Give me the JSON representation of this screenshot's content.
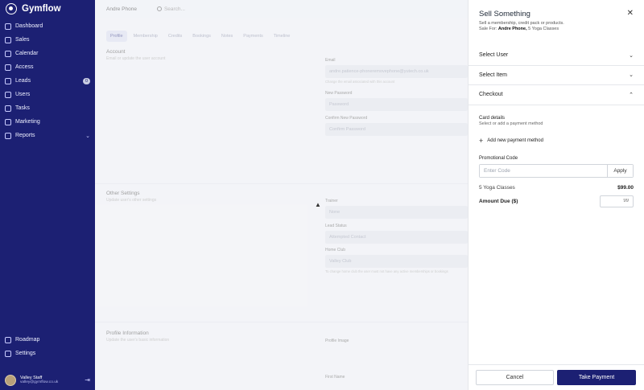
{
  "brand": {
    "name": "Gymflow"
  },
  "sidebar": {
    "items": [
      {
        "label": "Dashboard",
        "icon": "dashboard-icon"
      },
      {
        "label": "Sales",
        "icon": "sales-icon"
      },
      {
        "label": "Calendar",
        "icon": "calendar-icon"
      },
      {
        "label": "Access",
        "icon": "access-icon"
      },
      {
        "label": "Leads",
        "icon": "leads-icon",
        "badge": "0"
      },
      {
        "label": "Users",
        "icon": "users-icon"
      },
      {
        "label": "Tasks",
        "icon": "tasks-icon"
      },
      {
        "label": "Marketing",
        "icon": "marketing-icon"
      },
      {
        "label": "Reports",
        "icon": "reports-icon"
      }
    ],
    "bottom_items": [
      {
        "label": "Roadmap",
        "icon": "roadmap-icon"
      },
      {
        "label": "Settings",
        "icon": "settings-icon"
      }
    ],
    "user": {
      "name": "Valley Staff",
      "email": "valley@gymflow.co.uk"
    }
  },
  "topbar": {
    "member_name": "Andre Phone",
    "search_placeholder": "Search..."
  },
  "tabs": [
    "Profile",
    "Membership",
    "Credits",
    "Bookings",
    "Notes",
    "Payments",
    "Timeline"
  ],
  "main": {
    "account": {
      "title": "Account",
      "subtitle": "Email or update the user account",
      "email_label": "Email",
      "email_value": "andre.patience-phoneremovephone@yutech.co.uk",
      "email_help": "Change the email associated with this account",
      "new_password_label": "New Password",
      "new_password_placeholder": "Password",
      "confirm_password_label": "Confirm New Password",
      "confirm_password_placeholder": "Confirm Password"
    },
    "other": {
      "title": "Other Settings",
      "subtitle": "Update user's other settings",
      "trainer_label": "Trainer",
      "trainer_value": "None",
      "lead_status_label": "Lead Status",
      "lead_status_value": "Attempted Contact",
      "home_club_label": "Home Club",
      "home_club_value": "Valley Club",
      "home_club_help": "To change home club the user must not have any active memberships or bookings"
    },
    "profile": {
      "title": "Profile Information",
      "subtitle": "Update the user's basic information",
      "image_label": "Profile Image",
      "first_name_label": "First Name"
    }
  },
  "drawer": {
    "title": "Sell Something",
    "subtitle": "Sell a membership, credit pack or products.",
    "sale_for_prefix": "Sale For:",
    "sale_for_name": "Andre Phone,",
    "sale_for_item": "5 Yoga Classes",
    "sections": [
      "Select User",
      "Select Item",
      "Checkout"
    ],
    "checkout": {
      "card_title": "Card details",
      "card_sub": "Select or add a payment method",
      "add_method": "Add new payment method",
      "promo_label": "Promotional Code",
      "promo_placeholder": "Enter Code",
      "apply_label": "Apply",
      "item_name": "5 Yoga Classes",
      "item_price": "$99.00",
      "amount_due_label": "Amount Due ($)",
      "amount_due_placeholder": "99"
    },
    "cancel_label": "Cancel",
    "pay_label": "Take Payment"
  },
  "colors": {
    "sidebar_bg": "#1c2073",
    "primary": "#1c2073"
  }
}
